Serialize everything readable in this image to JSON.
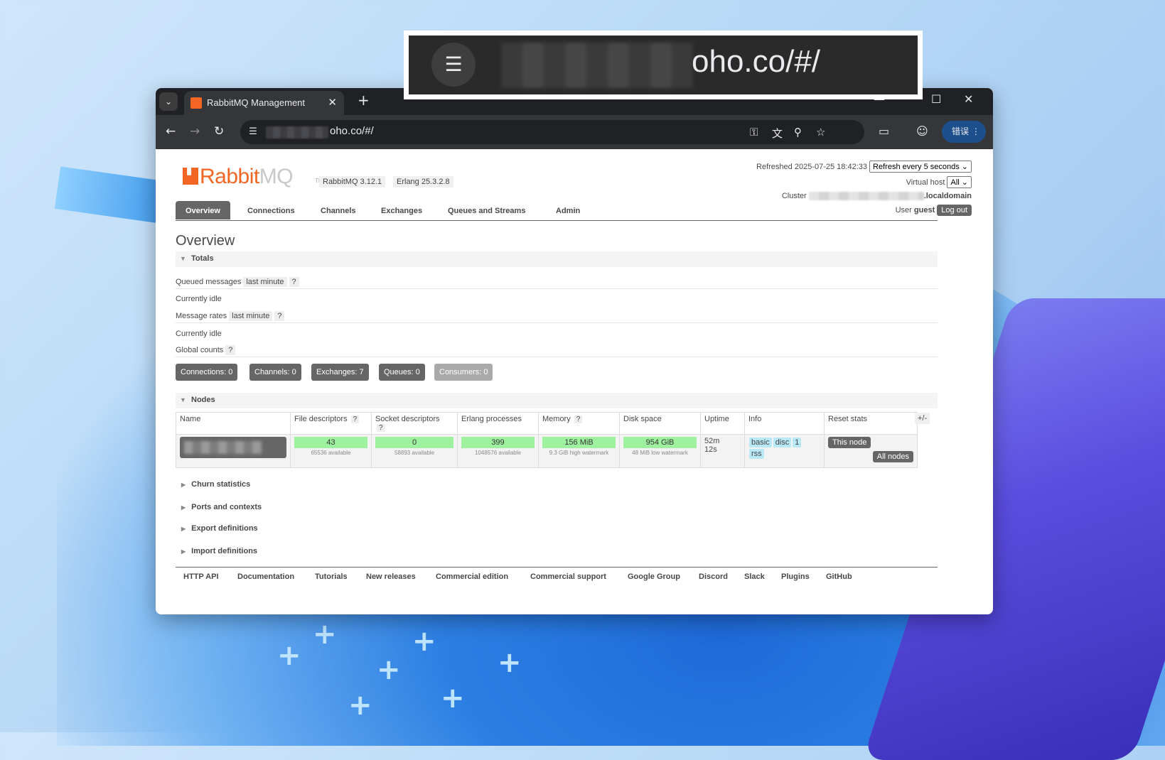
{
  "browser": {
    "tab_title": "RabbitMQ Management",
    "url_visible": "oho.co/#/",
    "profile_label": "错误",
    "zoom_url": "oho.co/#/"
  },
  "header": {
    "logo_rabbit": "Rabbit",
    "logo_mq": "MQ",
    "logo_tm": "TM",
    "rabbitmq_version": "RabbitMQ 3.12.1",
    "erlang_version": "Erlang 25.3.2.8",
    "refreshed_label": "Refreshed 2025-07-25 18:42:33",
    "refresh_select": "Refresh every 5 seconds",
    "vhost_label": "Virtual host",
    "vhost_select": "All",
    "cluster_label": "Cluster",
    "cluster_suffix": ".localdomain",
    "user_label": "User",
    "user_name": "guest",
    "logout_label": "Log out"
  },
  "tabs": [
    "Overview",
    "Connections",
    "Channels",
    "Exchanges",
    "Queues and Streams",
    "Admin"
  ],
  "page_title": "Overview",
  "totals": {
    "section_label": "Totals",
    "queued_label": "Queued messages",
    "queued_chip": "last minute",
    "help": "?",
    "idle_1": "Currently idle",
    "rates_label": "Message rates",
    "rates_chip": "last minute",
    "idle_2": "Currently idle",
    "global_label": "Global counts"
  },
  "counts": {
    "connections": "Connections: 0",
    "channels": "Channels: 0",
    "exchanges": "Exchanges: 7",
    "queues": "Queues: 0",
    "consumers": "Consumers: 0"
  },
  "nodes": {
    "section_label": "Nodes",
    "headers": [
      "Name",
      "File descriptors",
      "Socket descriptors",
      "Erlang processes",
      "Memory",
      "Disk space",
      "Uptime",
      "Info",
      "Reset stats"
    ],
    "plus_minus": "+/-",
    "file_desc": "43",
    "file_desc_sub": "65536 available",
    "socket_desc": "0",
    "socket_desc_sub": "58893 available",
    "erlang_proc": "399",
    "erlang_proc_sub": "1048576 available",
    "memory": "156 MiB",
    "memory_sub": "9.3 GiB high watermark",
    "disk": "954 GiB",
    "disk_sub": "48 MiB low watermark",
    "uptime_1": "52m",
    "uptime_2": "12s",
    "info_badges": [
      "basic",
      "disc",
      "1",
      "rss"
    ],
    "this_node": "This node",
    "all_nodes": "All nodes"
  },
  "collapsed_sections": [
    "Churn statistics",
    "Ports and contexts",
    "Export definitions",
    "Import definitions"
  ],
  "footer_links": [
    "HTTP API",
    "Documentation",
    "Tutorials",
    "New releases",
    "Commercial edition",
    "Commercial support",
    "Google Group",
    "Discord",
    "Slack",
    "Plugins",
    "GitHub"
  ],
  "colors": {
    "brand_orange": "#f26522",
    "meter_green": "#9ef19e",
    "info_blue": "#b9e8f7"
  }
}
